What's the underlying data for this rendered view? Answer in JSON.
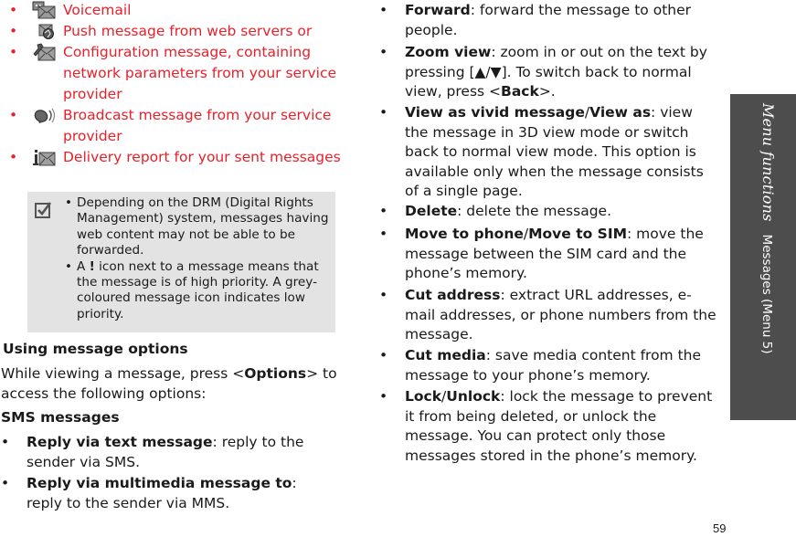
{
  "message_type_icons": [
    {
      "icon": "voicemail-icon",
      "label": "Voicemail"
    },
    {
      "icon": "push-message-icon",
      "label": "Push message from web servers or"
    },
    {
      "icon": "configuration-message-icon",
      "label": "Configuration message, containing network parameters from your service provider"
    },
    {
      "icon": "broadcast-message-icon",
      "label": "Broadcast message from your service provider"
    },
    {
      "icon": "delivery-report-icon",
      "label": "Delivery report for your sent messages"
    }
  ],
  "note": {
    "icon": "checkbox-note-icon",
    "items": [
      "Depending on the DRM (Digital Rights Management) system, messages having web content may not be able to be forwarded.",
      {
        "pre": "A ",
        "bold": "!",
        "post": " icon next to a message means that the message is of high priority. A grey-coloured message icon indicates low priority."
      }
    ]
  },
  "section": {
    "title": "Using message options",
    "intro_pre": "While viewing a message, press <",
    "intro_bold": "Options",
    "intro_post": "> to access the following options:",
    "subheading": "SMS messages"
  },
  "sms_options": [
    {
      "term": "Reply via text message",
      "desc": ": reply to the sender via SMS."
    },
    {
      "term": "Reply via multimedia message to",
      "desc": ": reply to the sender via MMS."
    }
  ],
  "options": [
    {
      "term": "Forward",
      "desc": ": forward the message to other people."
    },
    {
      "term": "Zoom view",
      "desc": ": zoom in or out on the text by pressing [▲/▼]. To switch back to normal view, press <",
      "bold2": "Back",
      "desc2": ">."
    },
    {
      "term": "View as vivid message",
      "sep": "/",
      "term2": "View as",
      "desc": ": view the message in 3D view mode or switch back to normal view mode. This option is available only when the message consists of a single page."
    },
    {
      "term": "Delete",
      "desc": ": delete the message."
    },
    {
      "term": "Move to phone",
      "sep": "/",
      "term2": "Move to SIM",
      "desc": ": move the message between the SIM card and the phone’s memory."
    },
    {
      "term": "Cut address",
      "desc": ": extract URL addresses, e-mail addresses, or phone numbers from the message."
    },
    {
      "term": "Cut media",
      "desc": ": save media content from the message to your phone’s memory."
    },
    {
      "term": "Lock",
      "sep": "/",
      "term2": "Unlock",
      "desc": ": lock the message to prevent it from being deleted, or unlock the message. You can protect only those messages stored in the phone’s memory."
    }
  ],
  "bullet": "•",
  "side_tab": {
    "chapter": "Menu functions",
    "section": "Messages  (Menu 5)"
  },
  "page_number": "59",
  "colors": {
    "accent_red": "#e8202a",
    "note_bg": "#e3e3e3",
    "side_tab_bg": "#4d4d4d"
  }
}
